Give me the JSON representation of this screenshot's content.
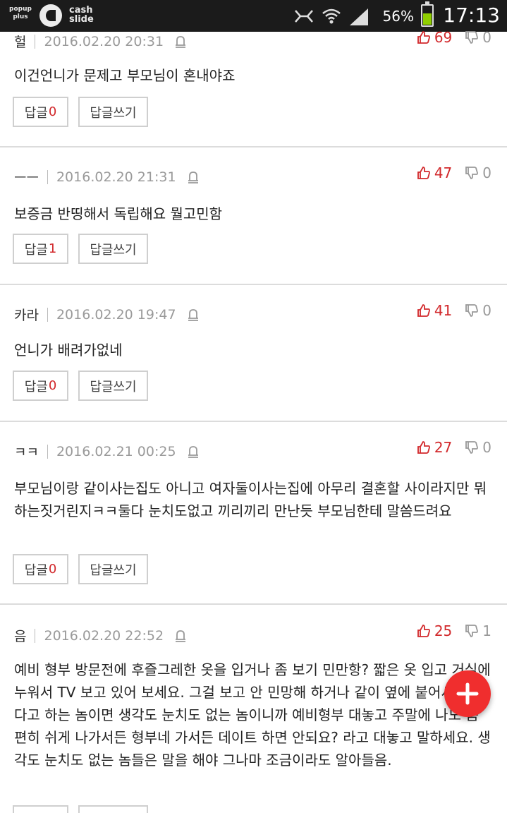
{
  "statusbar": {
    "popup_line1": "popup",
    "popup_line2": "plus",
    "cash_line1": "cash",
    "cash_line2": "slide",
    "battery_pct": "56%",
    "battery_level": 0.56,
    "time": "17:13"
  },
  "reply_label": "답글",
  "write_label": "답글쓰기",
  "comments": [
    {
      "author": "헐",
      "date": "2016.02.20 20:31",
      "up": "69",
      "down": "0",
      "text": "이건언니가 문제고 부모님이 혼내야죠",
      "replies": "0"
    },
    {
      "author": "ㅡㅡ",
      "date": "2016.02.20 21:31",
      "up": "47",
      "down": "0",
      "text": "보증금 반띵해서 독립해요 뭘고민함",
      "replies": "1"
    },
    {
      "author": "카라",
      "date": "2016.02.20 19:47",
      "up": "41",
      "down": "0",
      "text": "언니가 배려가없네",
      "replies": "0"
    },
    {
      "author": "ㅋㅋ",
      "date": "2016.02.21 00:25",
      "up": "27",
      "down": "0",
      "text": "부모님이랑 같이사는집도 아니고 여자둘이사는집에 아무리 결혼할 사이라지만 뭐하는짓거린지ㅋㅋ둘다 눈치도없고 끼리끼리 만난듯 부모님한테 말씀드려요",
      "replies": "0"
    },
    {
      "author": "음",
      "date": "2016.02.20 22:52",
      "up": "25",
      "down": "1",
      "text": "예비 형부 방문전에 후즐그레한 옷을 입거나 좀 보기 민만항? 짧은 옷 입고 거실에 누워서 TV 보고 있어 보세요. 그걸 보고 안 민망해 하거나 같이 옆에 붙어서 TV본다고 하는 놈이면 생각도 눈치도 없는 놈이니까 예비형부 대놓고 주말에 나도 좀 편히 쉬게 나가서든 형부네 가서든 데이트 하면 안되요? 라고 대놓고 말하세요. 생각도 눈치도 없는 놈들은 말을 해야 그나마 조금이라도 알아들음.",
      "replies": ""
    }
  ]
}
